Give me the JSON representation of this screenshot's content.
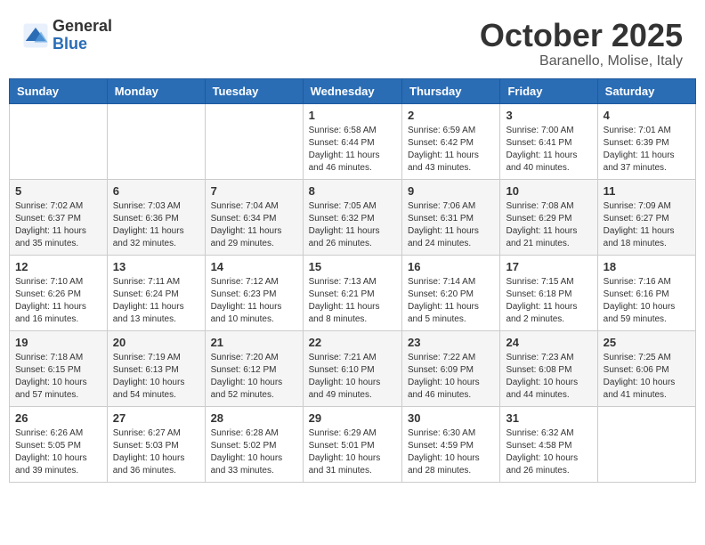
{
  "logo": {
    "general": "General",
    "blue": "Blue"
  },
  "title": "October 2025",
  "subtitle": "Baranello, Molise, Italy",
  "days_of_week": [
    "Sunday",
    "Monday",
    "Tuesday",
    "Wednesday",
    "Thursday",
    "Friday",
    "Saturday"
  ],
  "weeks": [
    [
      {
        "day": "",
        "info": ""
      },
      {
        "day": "",
        "info": ""
      },
      {
        "day": "",
        "info": ""
      },
      {
        "day": "1",
        "info": "Sunrise: 6:58 AM\nSunset: 6:44 PM\nDaylight: 11 hours and 46 minutes."
      },
      {
        "day": "2",
        "info": "Sunrise: 6:59 AM\nSunset: 6:42 PM\nDaylight: 11 hours and 43 minutes."
      },
      {
        "day": "3",
        "info": "Sunrise: 7:00 AM\nSunset: 6:41 PM\nDaylight: 11 hours and 40 minutes."
      },
      {
        "day": "4",
        "info": "Sunrise: 7:01 AM\nSunset: 6:39 PM\nDaylight: 11 hours and 37 minutes."
      }
    ],
    [
      {
        "day": "5",
        "info": "Sunrise: 7:02 AM\nSunset: 6:37 PM\nDaylight: 11 hours and 35 minutes."
      },
      {
        "day": "6",
        "info": "Sunrise: 7:03 AM\nSunset: 6:36 PM\nDaylight: 11 hours and 32 minutes."
      },
      {
        "day": "7",
        "info": "Sunrise: 7:04 AM\nSunset: 6:34 PM\nDaylight: 11 hours and 29 minutes."
      },
      {
        "day": "8",
        "info": "Sunrise: 7:05 AM\nSunset: 6:32 PM\nDaylight: 11 hours and 26 minutes."
      },
      {
        "day": "9",
        "info": "Sunrise: 7:06 AM\nSunset: 6:31 PM\nDaylight: 11 hours and 24 minutes."
      },
      {
        "day": "10",
        "info": "Sunrise: 7:08 AM\nSunset: 6:29 PM\nDaylight: 11 hours and 21 minutes."
      },
      {
        "day": "11",
        "info": "Sunrise: 7:09 AM\nSunset: 6:27 PM\nDaylight: 11 hours and 18 minutes."
      }
    ],
    [
      {
        "day": "12",
        "info": "Sunrise: 7:10 AM\nSunset: 6:26 PM\nDaylight: 11 hours and 16 minutes."
      },
      {
        "day": "13",
        "info": "Sunrise: 7:11 AM\nSunset: 6:24 PM\nDaylight: 11 hours and 13 minutes."
      },
      {
        "day": "14",
        "info": "Sunrise: 7:12 AM\nSunset: 6:23 PM\nDaylight: 11 hours and 10 minutes."
      },
      {
        "day": "15",
        "info": "Sunrise: 7:13 AM\nSunset: 6:21 PM\nDaylight: 11 hours and 8 minutes."
      },
      {
        "day": "16",
        "info": "Sunrise: 7:14 AM\nSunset: 6:20 PM\nDaylight: 11 hours and 5 minutes."
      },
      {
        "day": "17",
        "info": "Sunrise: 7:15 AM\nSunset: 6:18 PM\nDaylight: 11 hours and 2 minutes."
      },
      {
        "day": "18",
        "info": "Sunrise: 7:16 AM\nSunset: 6:16 PM\nDaylight: 10 hours and 59 minutes."
      }
    ],
    [
      {
        "day": "19",
        "info": "Sunrise: 7:18 AM\nSunset: 6:15 PM\nDaylight: 10 hours and 57 minutes."
      },
      {
        "day": "20",
        "info": "Sunrise: 7:19 AM\nSunset: 6:13 PM\nDaylight: 10 hours and 54 minutes."
      },
      {
        "day": "21",
        "info": "Sunrise: 7:20 AM\nSunset: 6:12 PM\nDaylight: 10 hours and 52 minutes."
      },
      {
        "day": "22",
        "info": "Sunrise: 7:21 AM\nSunset: 6:10 PM\nDaylight: 10 hours and 49 minutes."
      },
      {
        "day": "23",
        "info": "Sunrise: 7:22 AM\nSunset: 6:09 PM\nDaylight: 10 hours and 46 minutes."
      },
      {
        "day": "24",
        "info": "Sunrise: 7:23 AM\nSunset: 6:08 PM\nDaylight: 10 hours and 44 minutes."
      },
      {
        "day": "25",
        "info": "Sunrise: 7:25 AM\nSunset: 6:06 PM\nDaylight: 10 hours and 41 minutes."
      }
    ],
    [
      {
        "day": "26",
        "info": "Sunrise: 6:26 AM\nSunset: 5:05 PM\nDaylight: 10 hours and 39 minutes."
      },
      {
        "day": "27",
        "info": "Sunrise: 6:27 AM\nSunset: 5:03 PM\nDaylight: 10 hours and 36 minutes."
      },
      {
        "day": "28",
        "info": "Sunrise: 6:28 AM\nSunset: 5:02 PM\nDaylight: 10 hours and 33 minutes."
      },
      {
        "day": "29",
        "info": "Sunrise: 6:29 AM\nSunset: 5:01 PM\nDaylight: 10 hours and 31 minutes."
      },
      {
        "day": "30",
        "info": "Sunrise: 6:30 AM\nSunset: 4:59 PM\nDaylight: 10 hours and 28 minutes."
      },
      {
        "day": "31",
        "info": "Sunrise: 6:32 AM\nSunset: 4:58 PM\nDaylight: 10 hours and 26 minutes."
      },
      {
        "day": "",
        "info": ""
      }
    ]
  ]
}
